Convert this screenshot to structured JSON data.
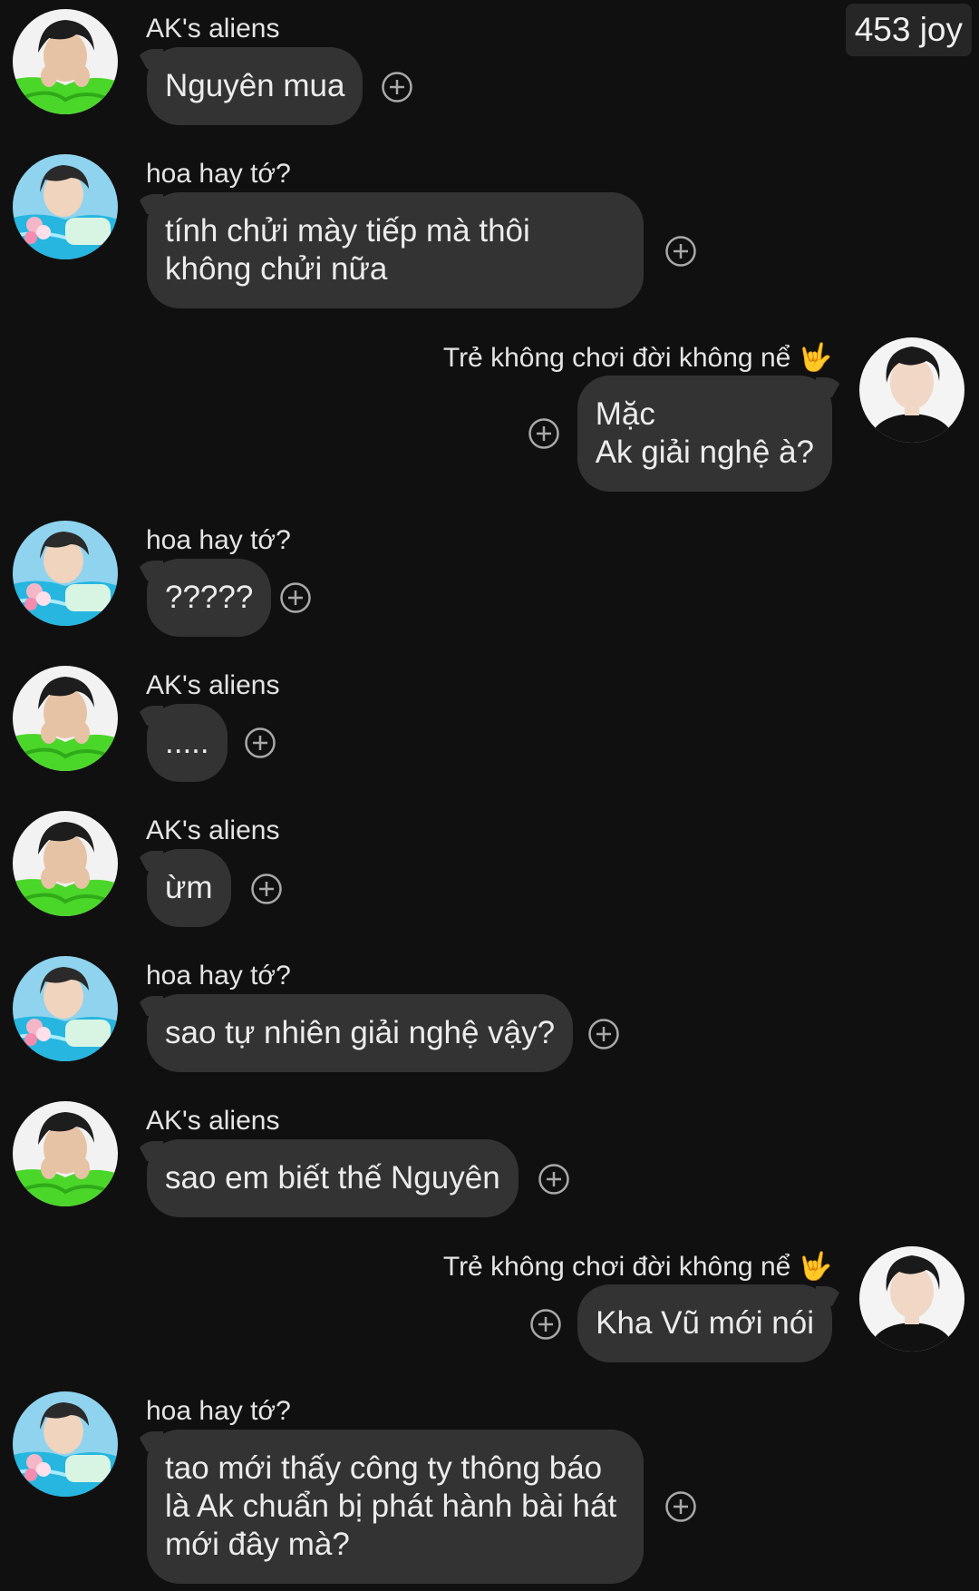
{
  "header": {
    "joy_badge": "453 joy"
  },
  "colors": {
    "background": "#101010",
    "bubble": "#333333",
    "text": "#ececec",
    "name_text": "#e4e4e4",
    "icon": "#a9a9a9"
  },
  "messages": [
    {
      "sender": "AK's aliens",
      "side": "left",
      "avatar": "avatar-green-shirt",
      "text": "Nguyên mua"
    },
    {
      "sender": "hoa hay tớ?",
      "side": "left",
      "avatar": "avatar-pool-flowers",
      "text": "tính chửi mày tiếp mà thôi\nkhông chửi nữa"
    },
    {
      "sender": "Trẻ không chơi đời không nể 🤟",
      "side": "right",
      "avatar": "avatar-black-shirt",
      "text": "Mặc\nAk giải nghệ à?"
    },
    {
      "sender": "hoa hay tớ?",
      "side": "left",
      "avatar": "avatar-pool-flowers",
      "text": "?????"
    },
    {
      "sender": "AK's aliens",
      "side": "left",
      "avatar": "avatar-green-shirt",
      "text": "....."
    },
    {
      "sender": "AK's aliens",
      "side": "left",
      "avatar": "avatar-green-shirt",
      "text": "ừm"
    },
    {
      "sender": "hoa hay tớ?",
      "side": "left",
      "avatar": "avatar-pool-flowers",
      "text": "sao tự nhiên giải nghệ vậy?"
    },
    {
      "sender": "AK's aliens",
      "side": "left",
      "avatar": "avatar-green-shirt",
      "text": "sao em biết thế Nguyên"
    },
    {
      "sender": "Trẻ không chơi đời không nể 🤟",
      "side": "right",
      "avatar": "avatar-black-shirt",
      "text": "Kha Vũ mới nói"
    },
    {
      "sender": "hoa hay tớ?",
      "side": "left",
      "avatar": "avatar-pool-flowers",
      "text": "tao mới thấy công ty thông báo\nlà Ak chuẩn bị phát hành bài hát\nmới đây mà?"
    }
  ],
  "icons": {
    "add_reaction": "plus-circle-icon"
  }
}
